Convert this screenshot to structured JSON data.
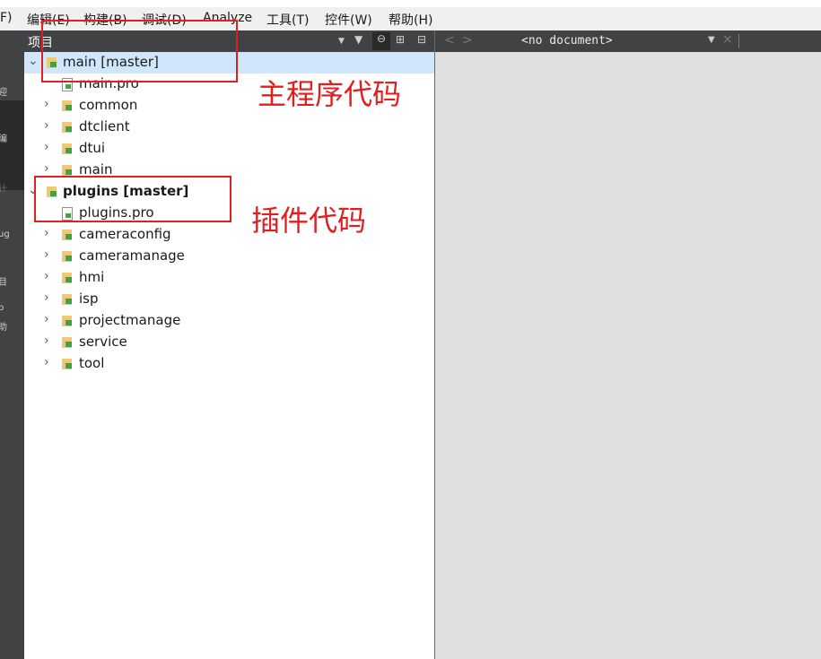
{
  "menubar": {
    "items": [
      "F)",
      "编辑(E)",
      "构建(B)",
      "调试(D)",
      "Analyze",
      "工具(T)",
      "控件(W)",
      "帮助(H)"
    ]
  },
  "modebar": {
    "labels": [
      "迎",
      "编",
      "计",
      "ug",
      "目",
      "p",
      "助"
    ]
  },
  "project_panel": {
    "title": "项目",
    "icons": [
      "dropdown-icon",
      "filter-icon",
      "link-icon",
      "split-icon",
      "close-panel-icon"
    ]
  },
  "tree": [
    {
      "label": "main [master]",
      "type": "project",
      "expanded": true,
      "selected": true,
      "bold": false
    },
    {
      "label": "main.pro",
      "type": "file"
    },
    {
      "label": "common",
      "type": "folder",
      "expanded": false
    },
    {
      "label": "dtclient",
      "type": "folder",
      "expanded": false
    },
    {
      "label": "dtui",
      "type": "folder",
      "expanded": false
    },
    {
      "label": "main",
      "type": "folder",
      "expanded": false
    },
    {
      "label": "plugins [master]",
      "type": "project",
      "expanded": true,
      "bold": true
    },
    {
      "label": "plugins.pro",
      "type": "file"
    },
    {
      "label": "cameraconfig",
      "type": "folder",
      "expanded": false
    },
    {
      "label": "cameramanage",
      "type": "folder",
      "expanded": false
    },
    {
      "label": "hmi",
      "type": "folder",
      "expanded": false
    },
    {
      "label": "isp",
      "type": "folder",
      "expanded": false
    },
    {
      "label": "projectmanage",
      "type": "folder",
      "expanded": false
    },
    {
      "label": "service",
      "type": "folder",
      "expanded": false
    },
    {
      "label": "tool",
      "type": "folder",
      "expanded": false
    }
  ],
  "editor": {
    "document": "<no document>",
    "nav_back": "<",
    "nav_forward": ">",
    "close": "×"
  },
  "annotations": {
    "main_note": "主程序代码",
    "plugins_note": "插件代码"
  },
  "colors": {
    "annotation": "#e02020",
    "selection": "#cfe6fb",
    "panel_header": "#404244",
    "editor_bg": "#e0e0e0"
  }
}
